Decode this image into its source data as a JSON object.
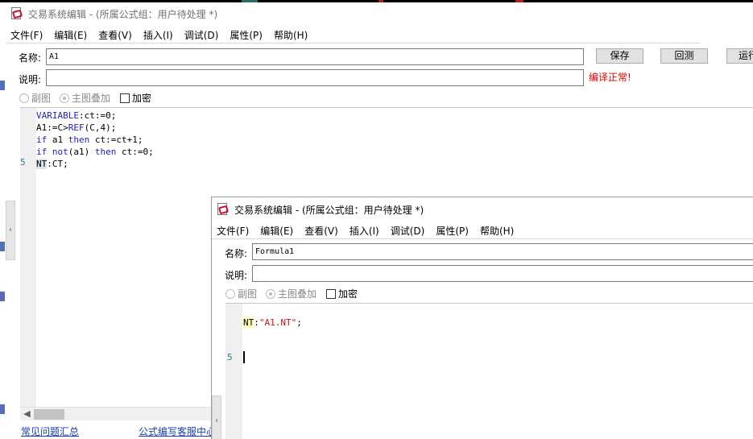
{
  "window_main": {
    "title": "交易系统编辑 - (所属公式组：用户待处理 *)",
    "menu": [
      "文件(F)",
      "编辑(E)",
      "查看(V)",
      "插入(I)",
      "调试(D)",
      "属性(P)",
      "帮助(H)"
    ],
    "name_label": "名称:",
    "name_value": "A1",
    "desc_label": "说明:",
    "desc_value": "",
    "buttons": {
      "save": "保存",
      "test": "回测",
      "run": "运行"
    },
    "compile_status": "编译正常!",
    "options": {
      "sub_chart": "副图",
      "main_overlay": "主图叠加",
      "encrypt": "加密"
    },
    "code_lines": [
      [
        {
          "t": "VARIABLE",
          "c": "kw"
        },
        {
          "t": ":ct:=0;",
          "c": ""
        }
      ],
      [
        {
          "t": "A1:=C>",
          "c": ""
        },
        {
          "t": "REF",
          "c": "fn"
        },
        {
          "t": "(C,4);",
          "c": ""
        }
      ],
      [
        {
          "t": "if",
          "c": "kw"
        },
        {
          "t": " a1 ",
          "c": ""
        },
        {
          "t": "then",
          "c": "kw"
        },
        {
          "t": " ct:=ct+1;",
          "c": ""
        }
      ],
      [
        {
          "t": "if",
          "c": "kw"
        },
        {
          "t": " ",
          "c": ""
        },
        {
          "t": "not",
          "c": "kw"
        },
        {
          "t": "(a1) ",
          "c": ""
        },
        {
          "t": "then",
          "c": "kw"
        },
        {
          "t": " ct:=0;",
          "c": ""
        }
      ],
      [
        {
          "t": "NT",
          "c": "hl"
        },
        {
          "t": ":CT;",
          "c": ""
        }
      ]
    ],
    "line_number": "5",
    "links": {
      "faq": "常见问题汇总",
      "service": "公式编写客服中心"
    }
  },
  "window_sub": {
    "title": "交易系统编辑 - (所属公式组：用户待处理 *)",
    "menu": [
      "文件(F)",
      "编辑(E)",
      "查看(V)",
      "插入(I)",
      "调试(D)",
      "属性(P)",
      "帮助(H)"
    ],
    "name_label": "名称:",
    "name_value": "Formula1",
    "desc_label": "说明:",
    "desc_value": "",
    "options": {
      "sub_chart": "副图",
      "main_overlay": "主图叠加",
      "encrypt": "加密"
    },
    "code_lines": [
      [],
      [
        {
          "t": "NT",
          "c": "hly"
        },
        {
          "t": ":",
          "c": ""
        },
        {
          "t": "\"A1.NT\"",
          "c": "str"
        },
        {
          "t": ";",
          "c": ""
        }
      ],
      [],
      []
    ],
    "line_number": "5"
  },
  "icons": {
    "app": "formula-editor-icon",
    "left_arrow": "chevron-left-icon"
  }
}
